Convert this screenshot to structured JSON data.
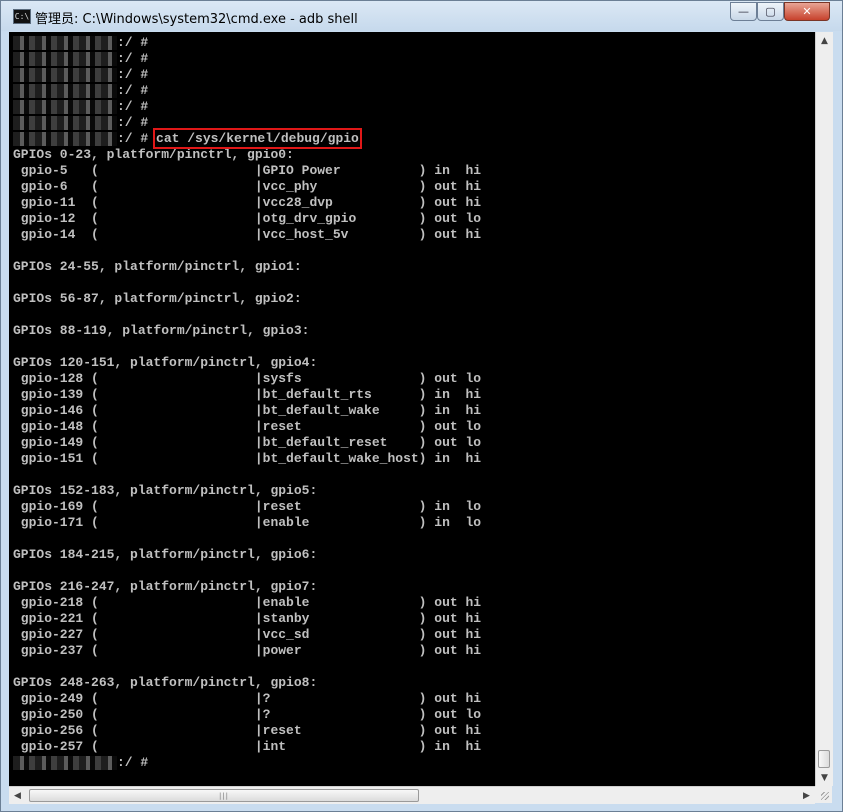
{
  "window": {
    "title": "管理员: C:\\Windows\\system32\\cmd.exe - adb  shell",
    "app_icon_text": "C:\\",
    "minimize_glyph": "—",
    "maximize_glyph": "▢",
    "close_glyph": "✕"
  },
  "console": {
    "highlighted_command": "cat /sys/kernel/debug/gpio",
    "lines": [
      {
        "redacted": true,
        "text": ":/ #"
      },
      {
        "redacted": true,
        "text": ":/ #"
      },
      {
        "redacted": true,
        "text": ":/ #"
      },
      {
        "redacted": true,
        "text": ":/ #"
      },
      {
        "redacted": true,
        "text": ":/ #"
      },
      {
        "redacted": true,
        "text": ":/ #"
      },
      {
        "redacted": true,
        "text": ":/ # ",
        "highlight": true
      },
      {
        "text": "GPIOs 0-23, platform/pinctrl, gpio0:"
      },
      {
        "text": " gpio-5   (                    |GPIO Power          ) in  hi"
      },
      {
        "text": " gpio-6   (                    |vcc_phy             ) out hi"
      },
      {
        "text": " gpio-11  (                    |vcc28_dvp           ) out hi"
      },
      {
        "text": " gpio-12  (                    |otg_drv_gpio        ) out lo"
      },
      {
        "text": " gpio-14  (                    |vcc_host_5v         ) out hi"
      },
      {
        "text": ""
      },
      {
        "text": "GPIOs 24-55, platform/pinctrl, gpio1:"
      },
      {
        "text": ""
      },
      {
        "text": "GPIOs 56-87, platform/pinctrl, gpio2:"
      },
      {
        "text": ""
      },
      {
        "text": "GPIOs 88-119, platform/pinctrl, gpio3:"
      },
      {
        "text": ""
      },
      {
        "text": "GPIOs 120-151, platform/pinctrl, gpio4:"
      },
      {
        "text": " gpio-128 (                    |sysfs               ) out lo"
      },
      {
        "text": " gpio-139 (                    |bt_default_rts      ) in  hi"
      },
      {
        "text": " gpio-146 (                    |bt_default_wake     ) in  hi"
      },
      {
        "text": " gpio-148 (                    |reset               ) out lo"
      },
      {
        "text": " gpio-149 (                    |bt_default_reset    ) out lo"
      },
      {
        "text": " gpio-151 (                    |bt_default_wake_host) in  hi"
      },
      {
        "text": ""
      },
      {
        "text": "GPIOs 152-183, platform/pinctrl, gpio5:"
      },
      {
        "text": " gpio-169 (                    |reset               ) in  lo"
      },
      {
        "text": " gpio-171 (                    |enable              ) in  lo"
      },
      {
        "text": ""
      },
      {
        "text": "GPIOs 184-215, platform/pinctrl, gpio6:"
      },
      {
        "text": ""
      },
      {
        "text": "GPIOs 216-247, platform/pinctrl, gpio7:"
      },
      {
        "text": " gpio-218 (                    |enable              ) out hi"
      },
      {
        "text": " gpio-221 (                    |stanby              ) out hi"
      },
      {
        "text": " gpio-227 (                    |vcc_sd              ) out hi"
      },
      {
        "text": " gpio-237 (                    |power               ) out hi"
      },
      {
        "text": ""
      },
      {
        "text": "GPIOs 248-263, platform/pinctrl, gpio8:"
      },
      {
        "text": " gpio-249 (                    |?                   ) out hi"
      },
      {
        "text": " gpio-250 (                    |?                   ) out lo"
      },
      {
        "text": " gpio-256 (                    |reset               ) out hi"
      },
      {
        "text": " gpio-257 (                    |int                 ) in  hi"
      },
      {
        "redacted": true,
        "text": ":/ #"
      }
    ]
  },
  "scrollbars": {
    "up_glyph": "▲",
    "down_glyph": "▼",
    "left_glyph": "◀",
    "right_glyph": "▶",
    "thumb_grip": "|||"
  }
}
